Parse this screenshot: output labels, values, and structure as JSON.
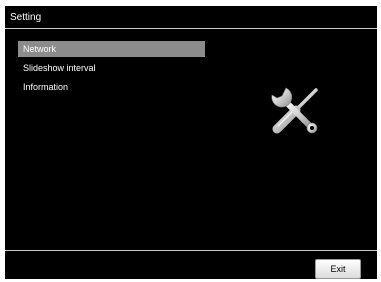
{
  "window": {
    "title": "Setting"
  },
  "menu": {
    "items": [
      {
        "label": "Network",
        "selected": true
      },
      {
        "label": "Slideshow interval",
        "selected": false
      },
      {
        "label": "Information",
        "selected": false
      }
    ]
  },
  "illustration": {
    "icon": "wrench-screwdriver-icon"
  },
  "footer": {
    "exit_label": "Exit"
  },
  "colors": {
    "background": "#000000",
    "selected_item": "#8c8c8c",
    "text": "#ffffff"
  }
}
